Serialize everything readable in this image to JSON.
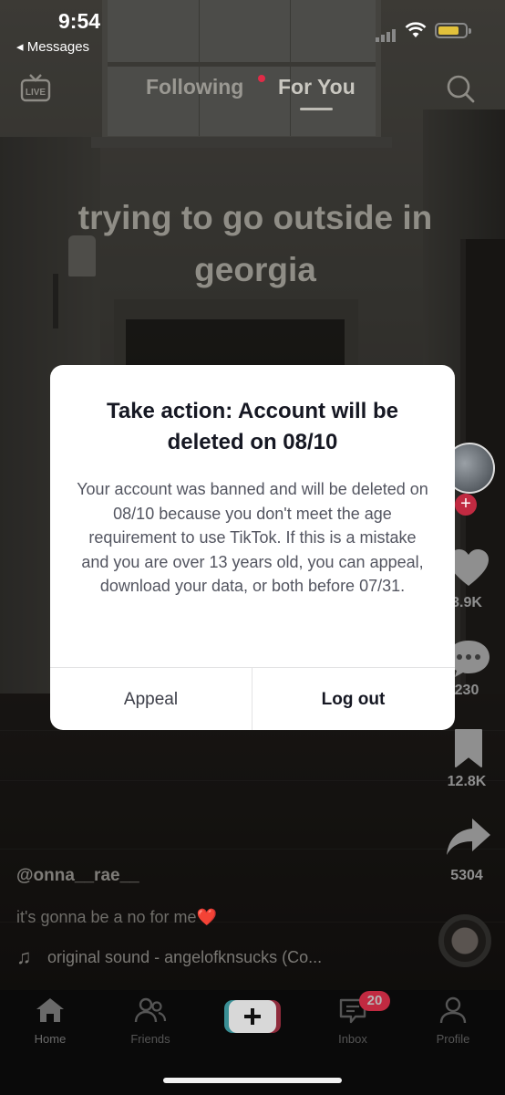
{
  "status_bar": {
    "time": "9:54",
    "back_label": "◂ Messages",
    "battery_color": "#e2c13b"
  },
  "top_nav": {
    "live_icon": "live-tv-icon",
    "tabs": [
      {
        "label": "Following",
        "has_dot": true
      },
      {
        "label": "For You",
        "active": true
      }
    ],
    "search_icon": "search-icon"
  },
  "video": {
    "caption": "trying to go outside in georgia",
    "username": "@onna__rae__",
    "description": "it's gonna be a no for me",
    "description_emoji": "❤️",
    "sound": "original sound - angelofknsucks (Co..."
  },
  "rail": {
    "likes": "3.9K",
    "comments": "230",
    "saves": "12.8K",
    "shares": "5304"
  },
  "bottom_nav": {
    "items": [
      {
        "label": "Home",
        "icon": "home-icon"
      },
      {
        "label": "Friends",
        "icon": "friends-icon"
      },
      {
        "label": "",
        "icon": "create-plus-icon"
      },
      {
        "label": "Inbox",
        "icon": "inbox-icon",
        "badge": "20"
      },
      {
        "label": "Profile",
        "icon": "profile-icon"
      }
    ]
  },
  "modal": {
    "title": "Take action: Account will be deleted on 08/10",
    "body": "Your account was banned and will be deleted on 08/10 because you don't meet the age requirement to use TikTok. If this is a mistake and you are over 13 years old, you can appeal, download your data, or both before 07/31.",
    "appeal_label": "Appeal",
    "logout_label": "Log out"
  },
  "colors": {
    "accent_red": "#c12a41",
    "modal_bg": "#ffffff",
    "title_text": "#161823"
  }
}
